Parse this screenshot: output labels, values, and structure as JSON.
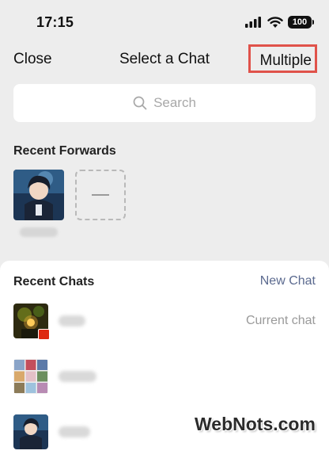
{
  "status_bar": {
    "time": "17:15",
    "battery": "100"
  },
  "nav": {
    "close_label": "Close",
    "title": "Select a Chat",
    "multiple_label": "Multiple"
  },
  "search": {
    "placeholder": "Search"
  },
  "recent_forwards": {
    "title": "Recent Forwards"
  },
  "recent_chats": {
    "title": "Recent Chats",
    "new_chat_label": "New Chat",
    "items": [
      {
        "status": "Current chat"
      },
      {
        "status": ""
      },
      {
        "status": ""
      }
    ]
  },
  "watermark": {
    "text": "WebNots.com",
    "logo_label": "WebNots"
  },
  "colors": {
    "highlight_border": "#e0524a",
    "link": "#5b6a8f",
    "flag": "#de2910"
  }
}
